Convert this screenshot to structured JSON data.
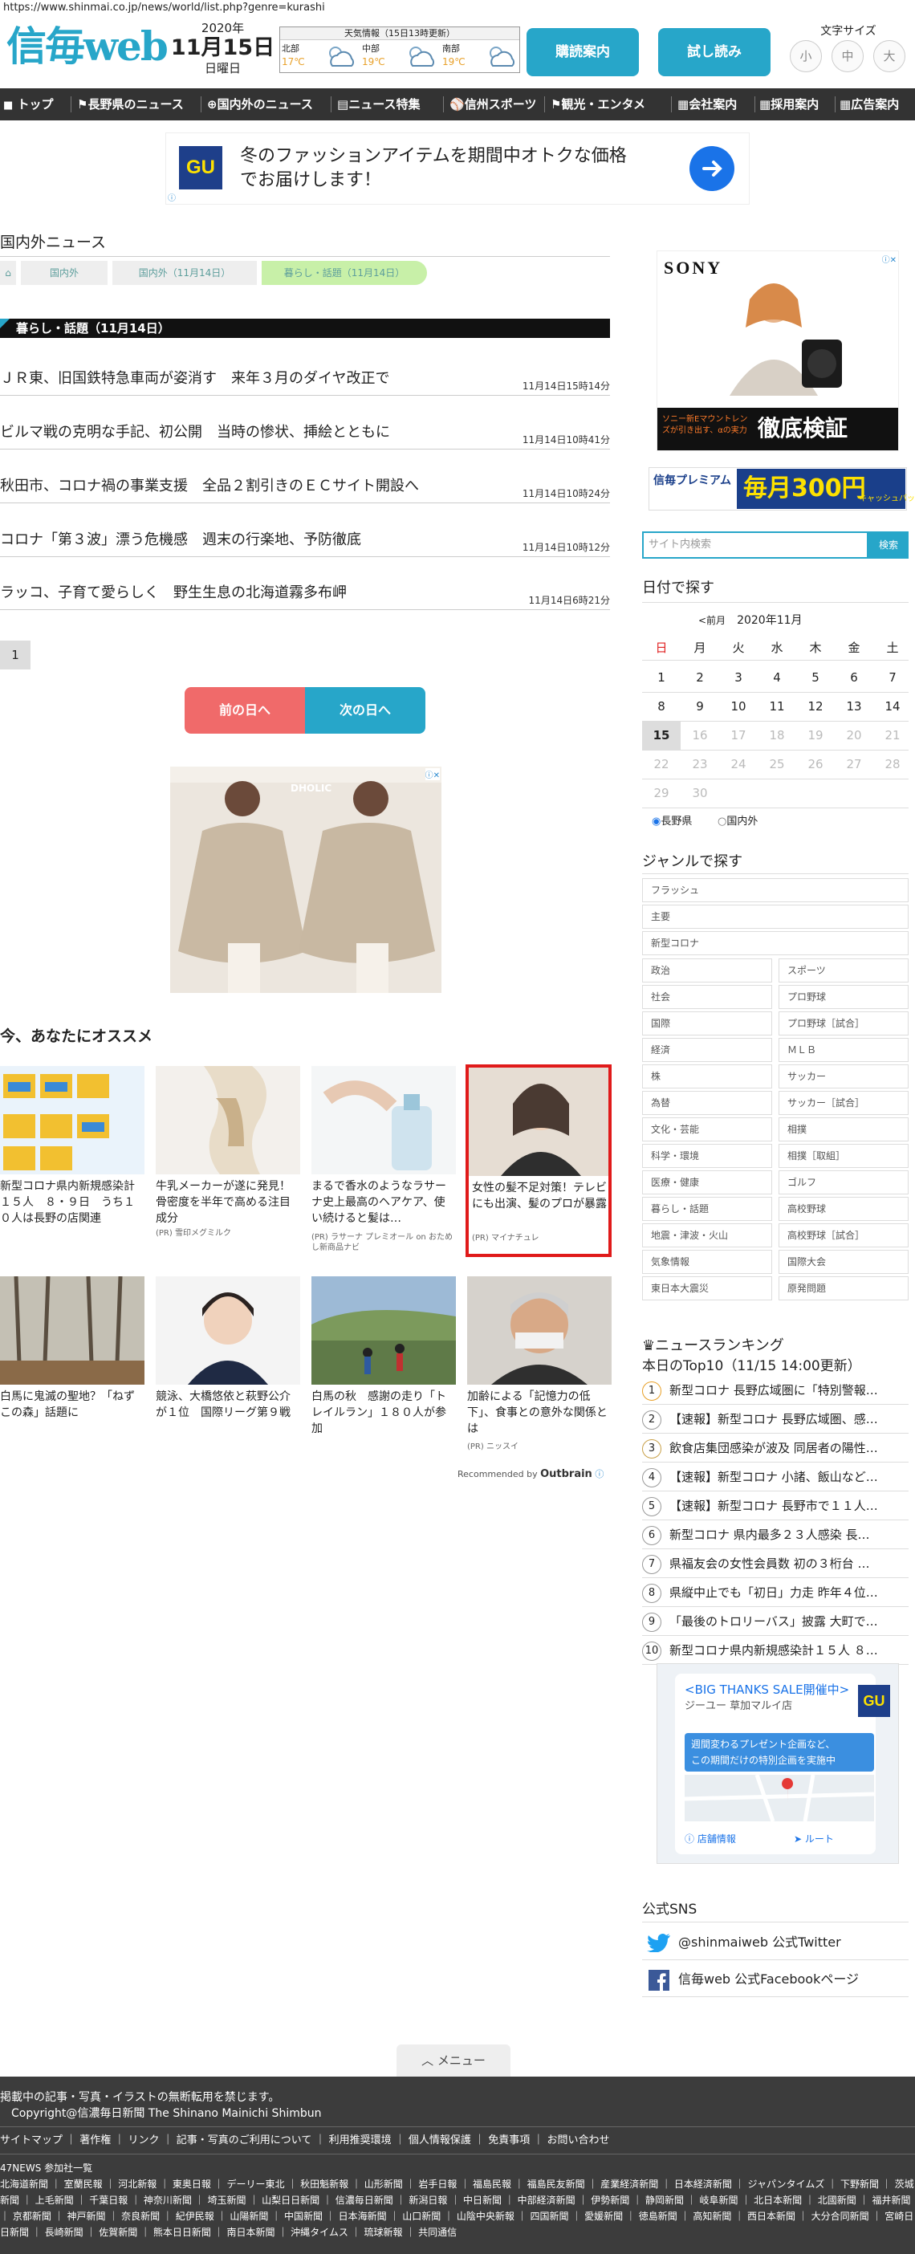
{
  "url": "https://www.shinmai.co.jp/news/world/list.php?genre=kurashi",
  "header": {
    "logo": "信毎web",
    "year": "2020年",
    "monthday": "11月15日",
    "weekday": "日曜日",
    "weather_title": "天気情報（15日13時更新）",
    "regions": [
      {
        "name": "北部",
        "temp": "17℃"
      },
      {
        "name": "中部",
        "temp": "19℃"
      },
      {
        "name": "南部",
        "temp": "19℃"
      }
    ],
    "subscribe_label": "購読案内",
    "trial_label": "試し読み",
    "font_size_label": "文字サイズ",
    "font_sizes": [
      "小",
      "中",
      "大"
    ]
  },
  "nav": [
    "トップ",
    "長野県のニュース",
    "国内外のニュース",
    "ニュース特集",
    "信州スポーツ",
    "観光・エンタメ",
    "会社案内",
    "採用案内",
    "広告案内"
  ],
  "top_ad": {
    "brand": "GU",
    "text_line1": "冬のファッションアイテムを期間中オトクな価格",
    "text_line2": "でお届けします！"
  },
  "section_title": "国内外ニュース",
  "breadcrumb": [
    "国内外",
    "国内外（11月14日）",
    "暮らし・話題（11月14日）"
  ],
  "genre_title": "暮らし・話題（11月14日）",
  "articles": [
    {
      "title": "ＪＲ東、旧国鉄特急車両が姿消す　来年３月のダイヤ改正で",
      "date": "11月14日15時14分"
    },
    {
      "title": "ビルマ戦の克明な手記、初公開　当時の惨状、挿絵とともに",
      "date": "11月14日10時41分"
    },
    {
      "title": "秋田市、コロナ禍の事業支援　全品２割引きのＥＣサイト開設へ",
      "date": "11月14日10時24分"
    },
    {
      "title": "コロナ「第３波」漂う危機感　週末の行楽地、予防徹底",
      "date": "11月14日10時12分"
    },
    {
      "title": "ラッコ、子育て愛らしく　野生生息の北海道霧多布岬",
      "date": "11月14日6時21分"
    }
  ],
  "pagination": [
    "1"
  ],
  "prev_day_label": "前の日へ",
  "next_day_label": "次の日へ",
  "fashion_ad_brand": "DHOLIC",
  "recommend": {
    "title": "今、あなたにオススメ",
    "row1": [
      {
        "title": "新型コロナ県内新規感染計１５人　８・９日　うち１０人は長野の店関連",
        "pr": ""
      },
      {
        "title": "牛乳メーカーが遂に発見！骨密度を半年で高める注目成分",
        "pr": "(PR) 雪印メグミルク"
      },
      {
        "title": "まるで香水のようなラサーナ史上最高のヘアケア、使い続けると髪は…",
        "pr": "(PR) ラサーナ プレミオール on おためし新商品ナビ"
      },
      {
        "title": "女性の髪不足対策！テレビにも出演、髪のプロが暴露",
        "pr": "(PR) マイナチュレ"
      }
    ],
    "row2": [
      {
        "title": "白馬に鬼滅の聖地？「ねずこの森」話題に",
        "pr": ""
      },
      {
        "title": "競泳、大橋悠依と萩野公介が１位　国際リーグ第９戦",
        "pr": ""
      },
      {
        "title": "白馬の秋　感謝の走り「トレイルラン」１８０人が参加",
        "pr": ""
      },
      {
        "title": "加齢による「記憶力の低下」、食事との意外な関係とは",
        "pr": "(PR) ニッスイ"
      }
    ],
    "by": "Recommended by",
    "by_brand": "Outbrain"
  },
  "sidebar": {
    "sony_ad": {
      "brand": "SONY",
      "caption": "ソニー新Eマウントレンズが引き出す、αの実力",
      "headline": "徹底検証"
    },
    "premium_ad": {
      "name": "信毎プレミアム",
      "text": "毎月300円",
      "sub": "キャッシュバック"
    },
    "search_placeholder": "サイト内検索",
    "search_button": "検索",
    "calendar": {
      "title": "日付で探す",
      "prev": "<前月",
      "month": "2020年11月",
      "weekdays": [
        "日",
        "月",
        "火",
        "水",
        "木",
        "金",
        "土"
      ],
      "weeks": [
        [
          "1",
          "2",
          "3",
          "4",
          "5",
          "6",
          "7"
        ],
        [
          "8",
          "9",
          "10",
          "11",
          "12",
          "13",
          "14"
        ],
        [
          "15",
          "16",
          "17",
          "18",
          "19",
          "20",
          "21"
        ],
        [
          "22",
          "23",
          "24",
          "25",
          "26",
          "27",
          "28"
        ],
        [
          "29",
          "30",
          "",
          "",
          "",
          "",
          ""
        ]
      ],
      "selected": "15",
      "radio_nagano": "長野県",
      "radio_world": "国内外"
    },
    "genre": {
      "title": "ジャンルで探す",
      "full": [
        "フラッシュ",
        "主要",
        "新型コロナ"
      ],
      "left": [
        "政治",
        "社会",
        "国際",
        "経済",
        "株",
        "為替",
        "文化・芸能",
        "科学・環境",
        "医療・健康",
        "暮らし・話題",
        "地震・津波・火山",
        "気象情報",
        "東日本大震災"
      ],
      "right": [
        "スポーツ",
        "プロ野球",
        "プロ野球［試合］",
        "ＭＬＢ",
        "サッカー",
        "サッカー［試合］",
        "相撲",
        "相撲［取組］",
        "ゴルフ",
        "高校野球",
        "高校野球［試合］",
        "国際大会",
        "原発問題"
      ]
    },
    "ranking": {
      "title": "ニュースランキング",
      "subtitle": "本日のTop10（11/15 14:00更新）",
      "items": [
        "新型コロナ 長野広域圏に「特別警報…",
        "【速報】新型コロナ 長野広域圏、感…",
        "飲食店集団感染が波及 同居者の陽性…",
        "【速報】新型コロナ 小諸、飯山など…",
        "【速報】新型コロナ 長野市で１１人…",
        "新型コロナ 県内最多２３人感染 長…",
        "県福友会の女性会員数 初の３桁台 …",
        "県縦中止でも「初日」力走 昨年４位…",
        "「最後のトロリーバス」披露 大町で…",
        "新型コロナ県内新規感染計１５人 ８…"
      ]
    },
    "map_ad": {
      "headline": "<BIG THANKS SALE開催中>",
      "store": "ジーユー 草加マルイ店",
      "blue_line1": "週間変わるプレゼント企画など、",
      "blue_line2": "この期間だけの特別企画を実施中",
      "info": "店舗情報",
      "route": "ルート"
    },
    "sns": {
      "title": "公式SNS",
      "twitter": "@shinmaiweb 公式Twitter",
      "facebook": "信毎web 公式Facebookページ"
    }
  },
  "menu_label": "メニュー",
  "footer": {
    "notice": "掲載中の記事・写真・イラストの無断転用を禁じます。",
    "copyright": "Copyright@信濃毎日新聞 The Shinano Mainichi Shimbun",
    "links": "サイトマップ ｜ 著作権 ｜ リンク ｜ 記事・写真のご利用について ｜ 利用推奨環境 ｜ 個人情報保護 ｜ 免責事項 ｜ お問い合わせ",
    "news47": "47NEWS 参加社一覧",
    "papers": "北海道新聞 ｜ 室蘭民報 ｜ 河北新報 ｜ 東奥日報 ｜ デーリー東北 ｜ 秋田魁新報 ｜ 山形新聞 ｜ 岩手日報 ｜ 福島民報 ｜ 福島民友新聞 ｜ 産業経済新聞 ｜ 日本経済新聞 ｜ ジャパンタイムズ ｜ 下野新聞 ｜ 茨城新聞 ｜ 上毛新聞 ｜ 千葉日報 ｜ 神奈川新聞 ｜ 埼玉新聞 ｜ 山梨日日新聞 ｜ 信濃毎日新聞 ｜ 新潟日報 ｜ 中日新聞 ｜ 中部経済新聞 ｜ 伊勢新聞 ｜ 静岡新聞 ｜ 岐阜新聞 ｜ 北日本新聞 ｜ 北國新聞 ｜ 福井新聞 ｜ 京都新聞 ｜ 神戸新聞 ｜ 奈良新聞 ｜ 紀伊民報 ｜ 山陽新聞 ｜ 中国新聞 ｜ 日本海新聞 ｜ 山口新聞 ｜ 山陰中央新報 ｜ 四国新聞 ｜ 愛媛新聞 ｜ 徳島新聞 ｜ 高知新聞 ｜ 西日本新聞 ｜ 大分合同新聞 ｜ 宮崎日日新聞 ｜ 長崎新聞 ｜ 佐賀新聞 ｜ 熊本日日新聞 ｜ 南日本新聞 ｜ 沖縄タイムス ｜ 琉球新報 ｜ 共同通信"
  }
}
